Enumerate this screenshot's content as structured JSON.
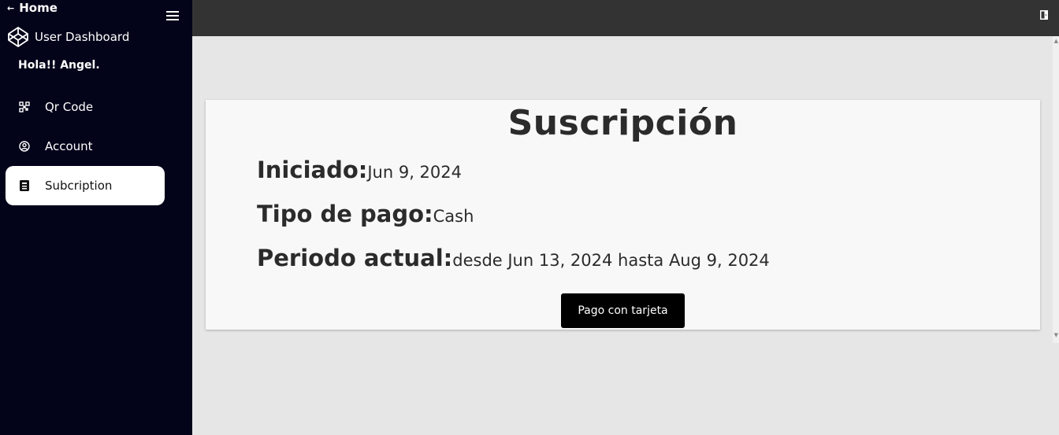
{
  "sidebar": {
    "home_label": "Home",
    "brand_label": "User Dashboard",
    "greeting": "Hola!! Angel.",
    "items": [
      {
        "label": "Qr Code",
        "icon": "qr-code-icon",
        "active": false
      },
      {
        "label": "Account",
        "icon": "user-circle-icon",
        "active": false
      },
      {
        "label": "Subcription",
        "icon": "id-card-icon",
        "active": true
      }
    ]
  },
  "card": {
    "title": "Suscripción",
    "started_label": "Iniciado:",
    "started_value": "Jun 9, 2024",
    "payment_type_label": "Tipo de pago:",
    "payment_type_value": "Cash",
    "period_label": "Periodo actual:",
    "period_value": "desde Jun 13, 2024 hasta Aug 9, 2024",
    "pay_button_label": "Pago con tarjeta"
  },
  "colors": {
    "sidebar_bg": "#03031a",
    "topbar_bg": "#333333",
    "content_bg": "#e6e6e6",
    "card_bg": "#f8f8f8",
    "button_bg": "#000000"
  }
}
